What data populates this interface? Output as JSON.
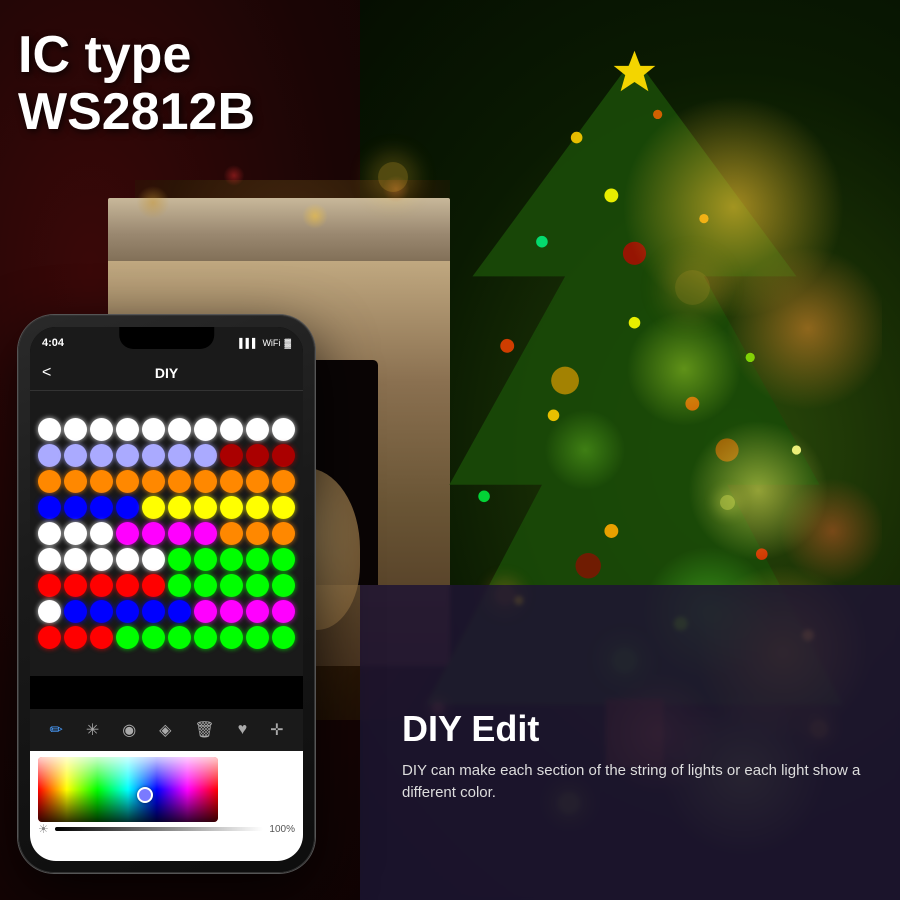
{
  "background": {
    "left_color": "#3a0808",
    "right_color": "#2a4a0a"
  },
  "ic_type": {
    "line1": "IC type",
    "line2": "WS2812B"
  },
  "phone": {
    "status_bar": {
      "time": "4:04",
      "signal": "▌▌▌",
      "wifi": "WiFi",
      "battery": "🔋"
    },
    "header": {
      "back": "<",
      "title": "DIY"
    },
    "toolbar": {
      "icons": [
        "✏️",
        "✳️",
        "🪣",
        "🖊️",
        "🗑️",
        "♥",
        "✛"
      ]
    },
    "brightness": {
      "icon": "☀",
      "value": "100%"
    }
  },
  "led_grid": {
    "rows": [
      [
        "#ffffff",
        "#ffffff",
        "#ffffff",
        "#ffffff",
        "#ffffff",
        "#ffffff",
        "#ffffff",
        "#ffffff",
        "#ffffff",
        "#ffffff"
      ],
      [
        "#aaaaff",
        "#aaaaff",
        "#aaaaff",
        "#aaaaff",
        "#aaaaff",
        "#aaaaff",
        "#aaaaff",
        "#aa0000",
        "#aa0000",
        "#aa0000"
      ],
      [
        "#ff8800",
        "#ff8800",
        "#ff8800",
        "#ff8800",
        "#ff8800",
        "#ff8800",
        "#ff8800",
        "#ff8800",
        "#ff8800",
        "#ff8800"
      ],
      [
        "#0000ff",
        "#0000ff",
        "#0000ff",
        "#0000ff",
        "#ffff00",
        "#ffff00",
        "#ffff00",
        "#ffff00",
        "#ffff00",
        "#ffff00"
      ],
      [
        "#ffffff",
        "#ffffff",
        "#ffffff",
        "#ff00ff",
        "#ff00ff",
        "#ff00ff",
        "#ff00ff",
        "#ff8800",
        "#ff8800",
        "#ff8800"
      ],
      [
        "#ffffff",
        "#ffffff",
        "#ffffff",
        "#ffffff",
        "#ffffff",
        "#00ff00",
        "#00ff00",
        "#00ff00",
        "#00ff00",
        "#00ff00"
      ],
      [
        "#ff0000",
        "#ff0000",
        "#ff0000",
        "#ff0000",
        "#ff0000",
        "#00ff00",
        "#00ff00",
        "#00ff00",
        "#00ff00",
        "#00ff00"
      ]
    ]
  },
  "diy_section": {
    "title": "DIY Edit",
    "description": "DIY can make each section of the string of lights or each light show a different color."
  }
}
